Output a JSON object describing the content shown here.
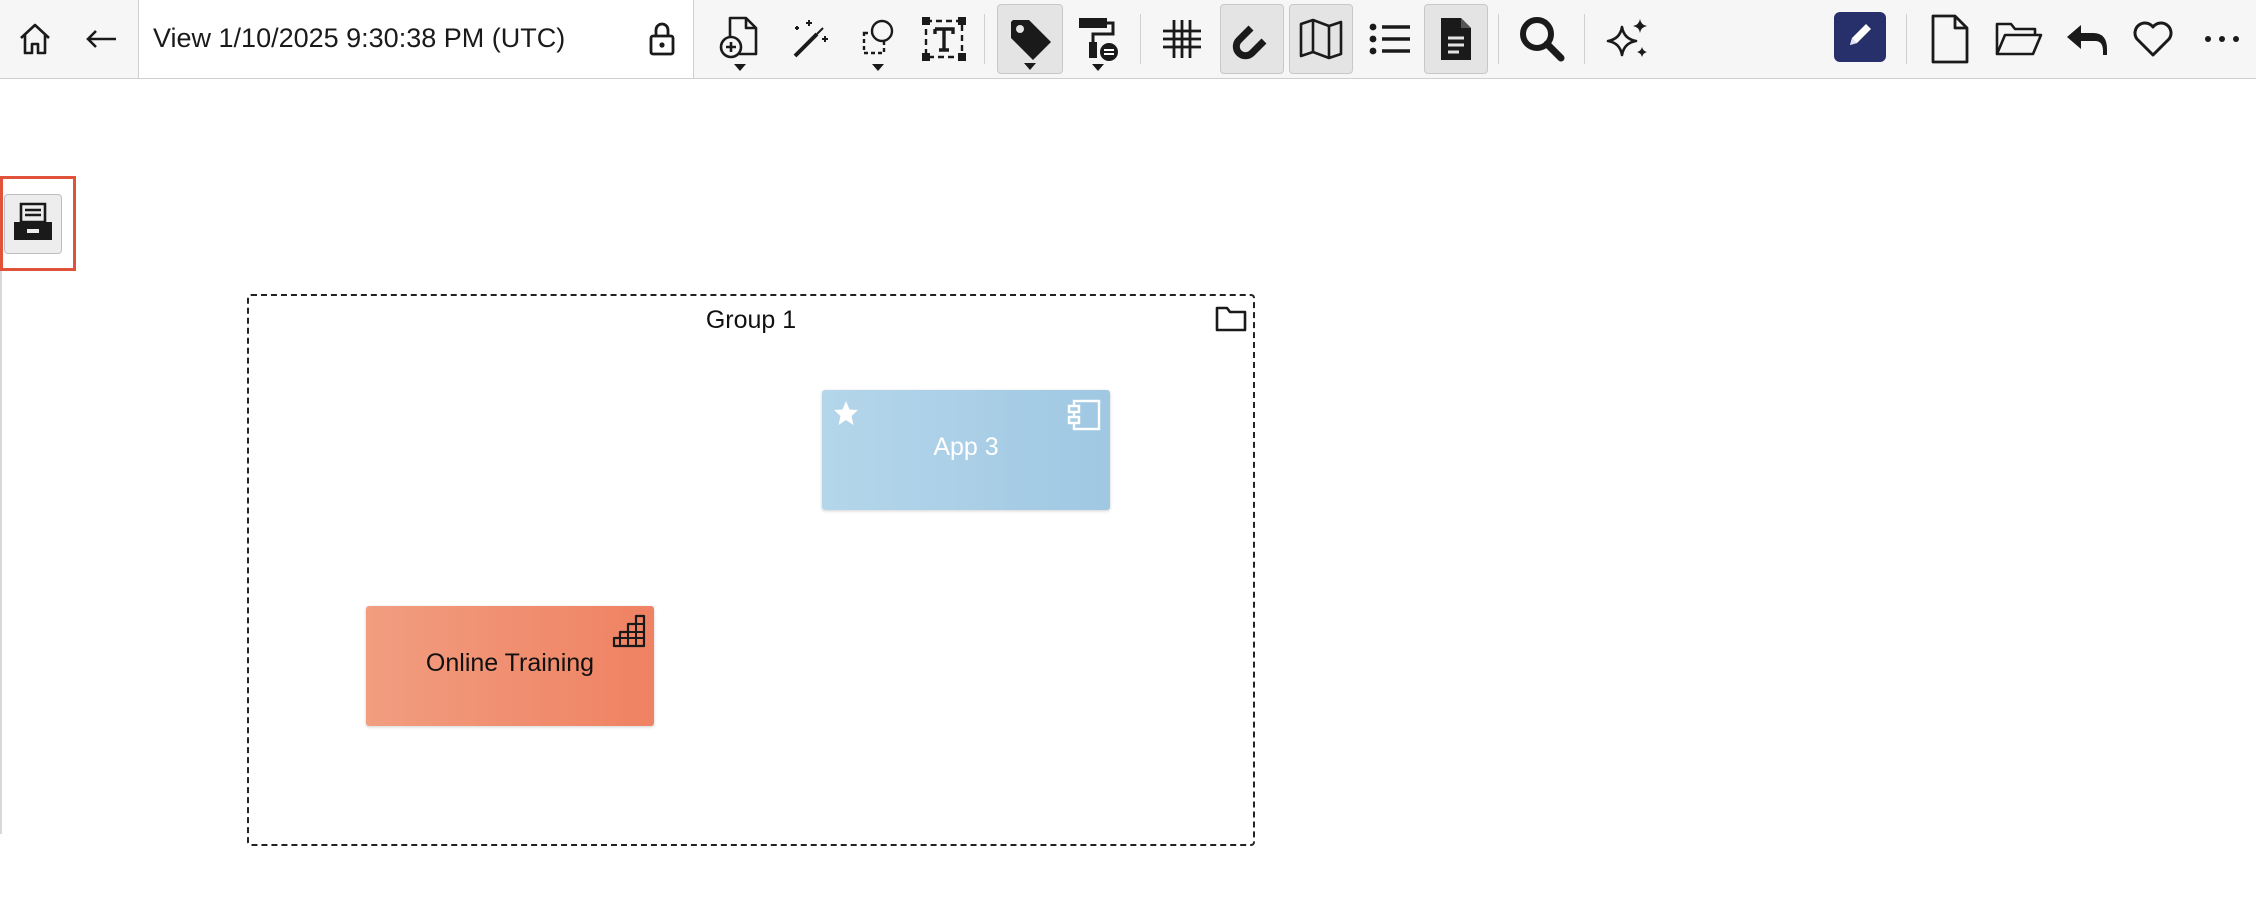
{
  "toolbar": {
    "view_title": "View 1/10/2025 9:30:38 PM (UTC)",
    "icons": [
      "home-icon",
      "back-arrow-icon",
      "lock-icon",
      "add-document-icon",
      "magic-wand-icon",
      "shapes-icon",
      "text-box-icon",
      "tag-icon",
      "format-painter-icon",
      "grid-icon",
      "magnet-icon",
      "map-icon",
      "list-icon",
      "document-icon",
      "search-icon",
      "sparkles-icon",
      "edit-pencil-icon",
      "new-file-icon",
      "open-folder-icon",
      "reply-icon",
      "heart-icon",
      "more-icon"
    ],
    "colors": {
      "edit_button": "#27306b",
      "toolbar_bg": "#f6f6f6"
    }
  },
  "canvas": {
    "palette_icon": "inbox-tray-icon",
    "highlight_color": "#e0523a",
    "group": {
      "title": "Group 1",
      "icon": "folder-icon"
    },
    "elements": [
      {
        "label": "App 3",
        "icons": [
          "star-icon",
          "component-icon"
        ],
        "color": "#a8cfe6"
      },
      {
        "label": "Online Training",
        "icons": [
          "stairs-icon"
        ],
        "color": "#f08e6f"
      }
    ]
  }
}
